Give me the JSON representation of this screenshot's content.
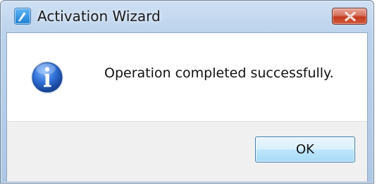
{
  "window": {
    "title": "Activation Wizard",
    "app_icon": "wizard-app-icon",
    "close_icon": "close-x-icon"
  },
  "dialog": {
    "icon": "information-icon",
    "message": "Operation completed successfully.",
    "ok_label": "OK"
  },
  "colors": {
    "frame": "#bcd3ec",
    "close_button": "#c23b1f",
    "content_bg": "#ffffff",
    "footer_bg": "#f0f0f0",
    "ok_button_border": "#3c7fb1"
  }
}
